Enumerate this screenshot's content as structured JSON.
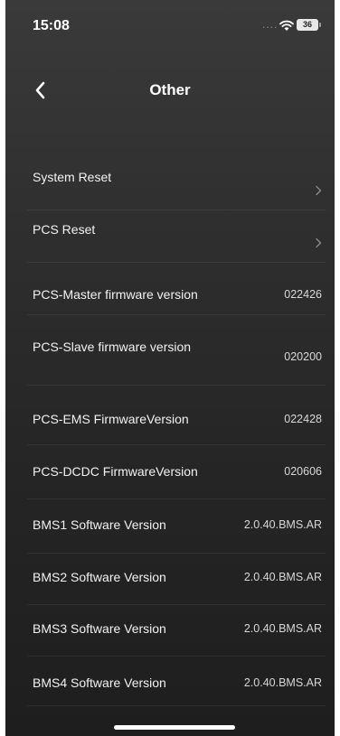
{
  "status_bar": {
    "time": "15:08",
    "signal": "....",
    "battery": "36"
  },
  "header": {
    "title": "Other"
  },
  "menu_items": [
    {
      "label": "System Reset"
    },
    {
      "label": "PCS Reset"
    }
  ],
  "info_items": [
    {
      "label": "PCS-Master firmware version",
      "value": "022426"
    },
    {
      "label": "PCS-Slave firmware version",
      "value": "020200"
    },
    {
      "label": "PCS-EMS FirmwareVersion",
      "value": "022428"
    },
    {
      "label": "PCS-DCDC FirmwareVersion",
      "value": "020606"
    },
    {
      "label": "BMS1 Software Version",
      "value": "2.0.40.BMS.AR"
    },
    {
      "label": "BMS2 Software Version",
      "value": "2.0.40.BMS.AR"
    },
    {
      "label": "BMS3 Software Version",
      "value": "2.0.40.BMS.AR"
    },
    {
      "label": "BMS4 Software Version",
      "value": "2.0.40.BMS.AR"
    }
  ]
}
